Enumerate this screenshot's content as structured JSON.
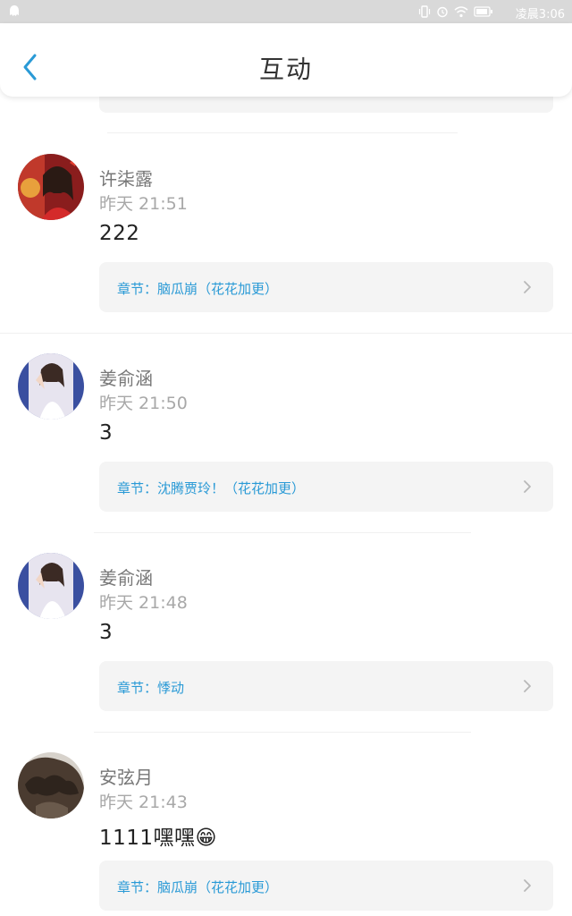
{
  "status_bar": {
    "time": "凌晨3:06",
    "icons": [
      "app-notification-icon",
      "vibrate-icon",
      "alarm-icon",
      "wifi-icon",
      "battery-icon"
    ]
  },
  "header": {
    "title": "互动",
    "back_icon": "chevron-left-icon"
  },
  "colors": {
    "accent": "#2a9ad6",
    "card_background": "#f4f4f4",
    "status_bar": "#d9d9d9"
  },
  "items": [
    {
      "user": "许柒露",
      "time": "昨天 21:51",
      "content": "222",
      "chapter": "章节：脑瓜崩（花花加更）"
    },
    {
      "user": "姜俞涵",
      "time": "昨天 21:50",
      "content": "3",
      "chapter": "章节：沈腾贾玲！（花花加更）"
    },
    {
      "user": "姜俞涵",
      "time": "昨天 21:48",
      "content": "3",
      "chapter": "章节：悸动"
    },
    {
      "user": "安弦月",
      "time": "昨天 21:43",
      "content": "1111嘿嘿😁",
      "chapter": "章节：脑瓜崩（花花加更）"
    }
  ]
}
